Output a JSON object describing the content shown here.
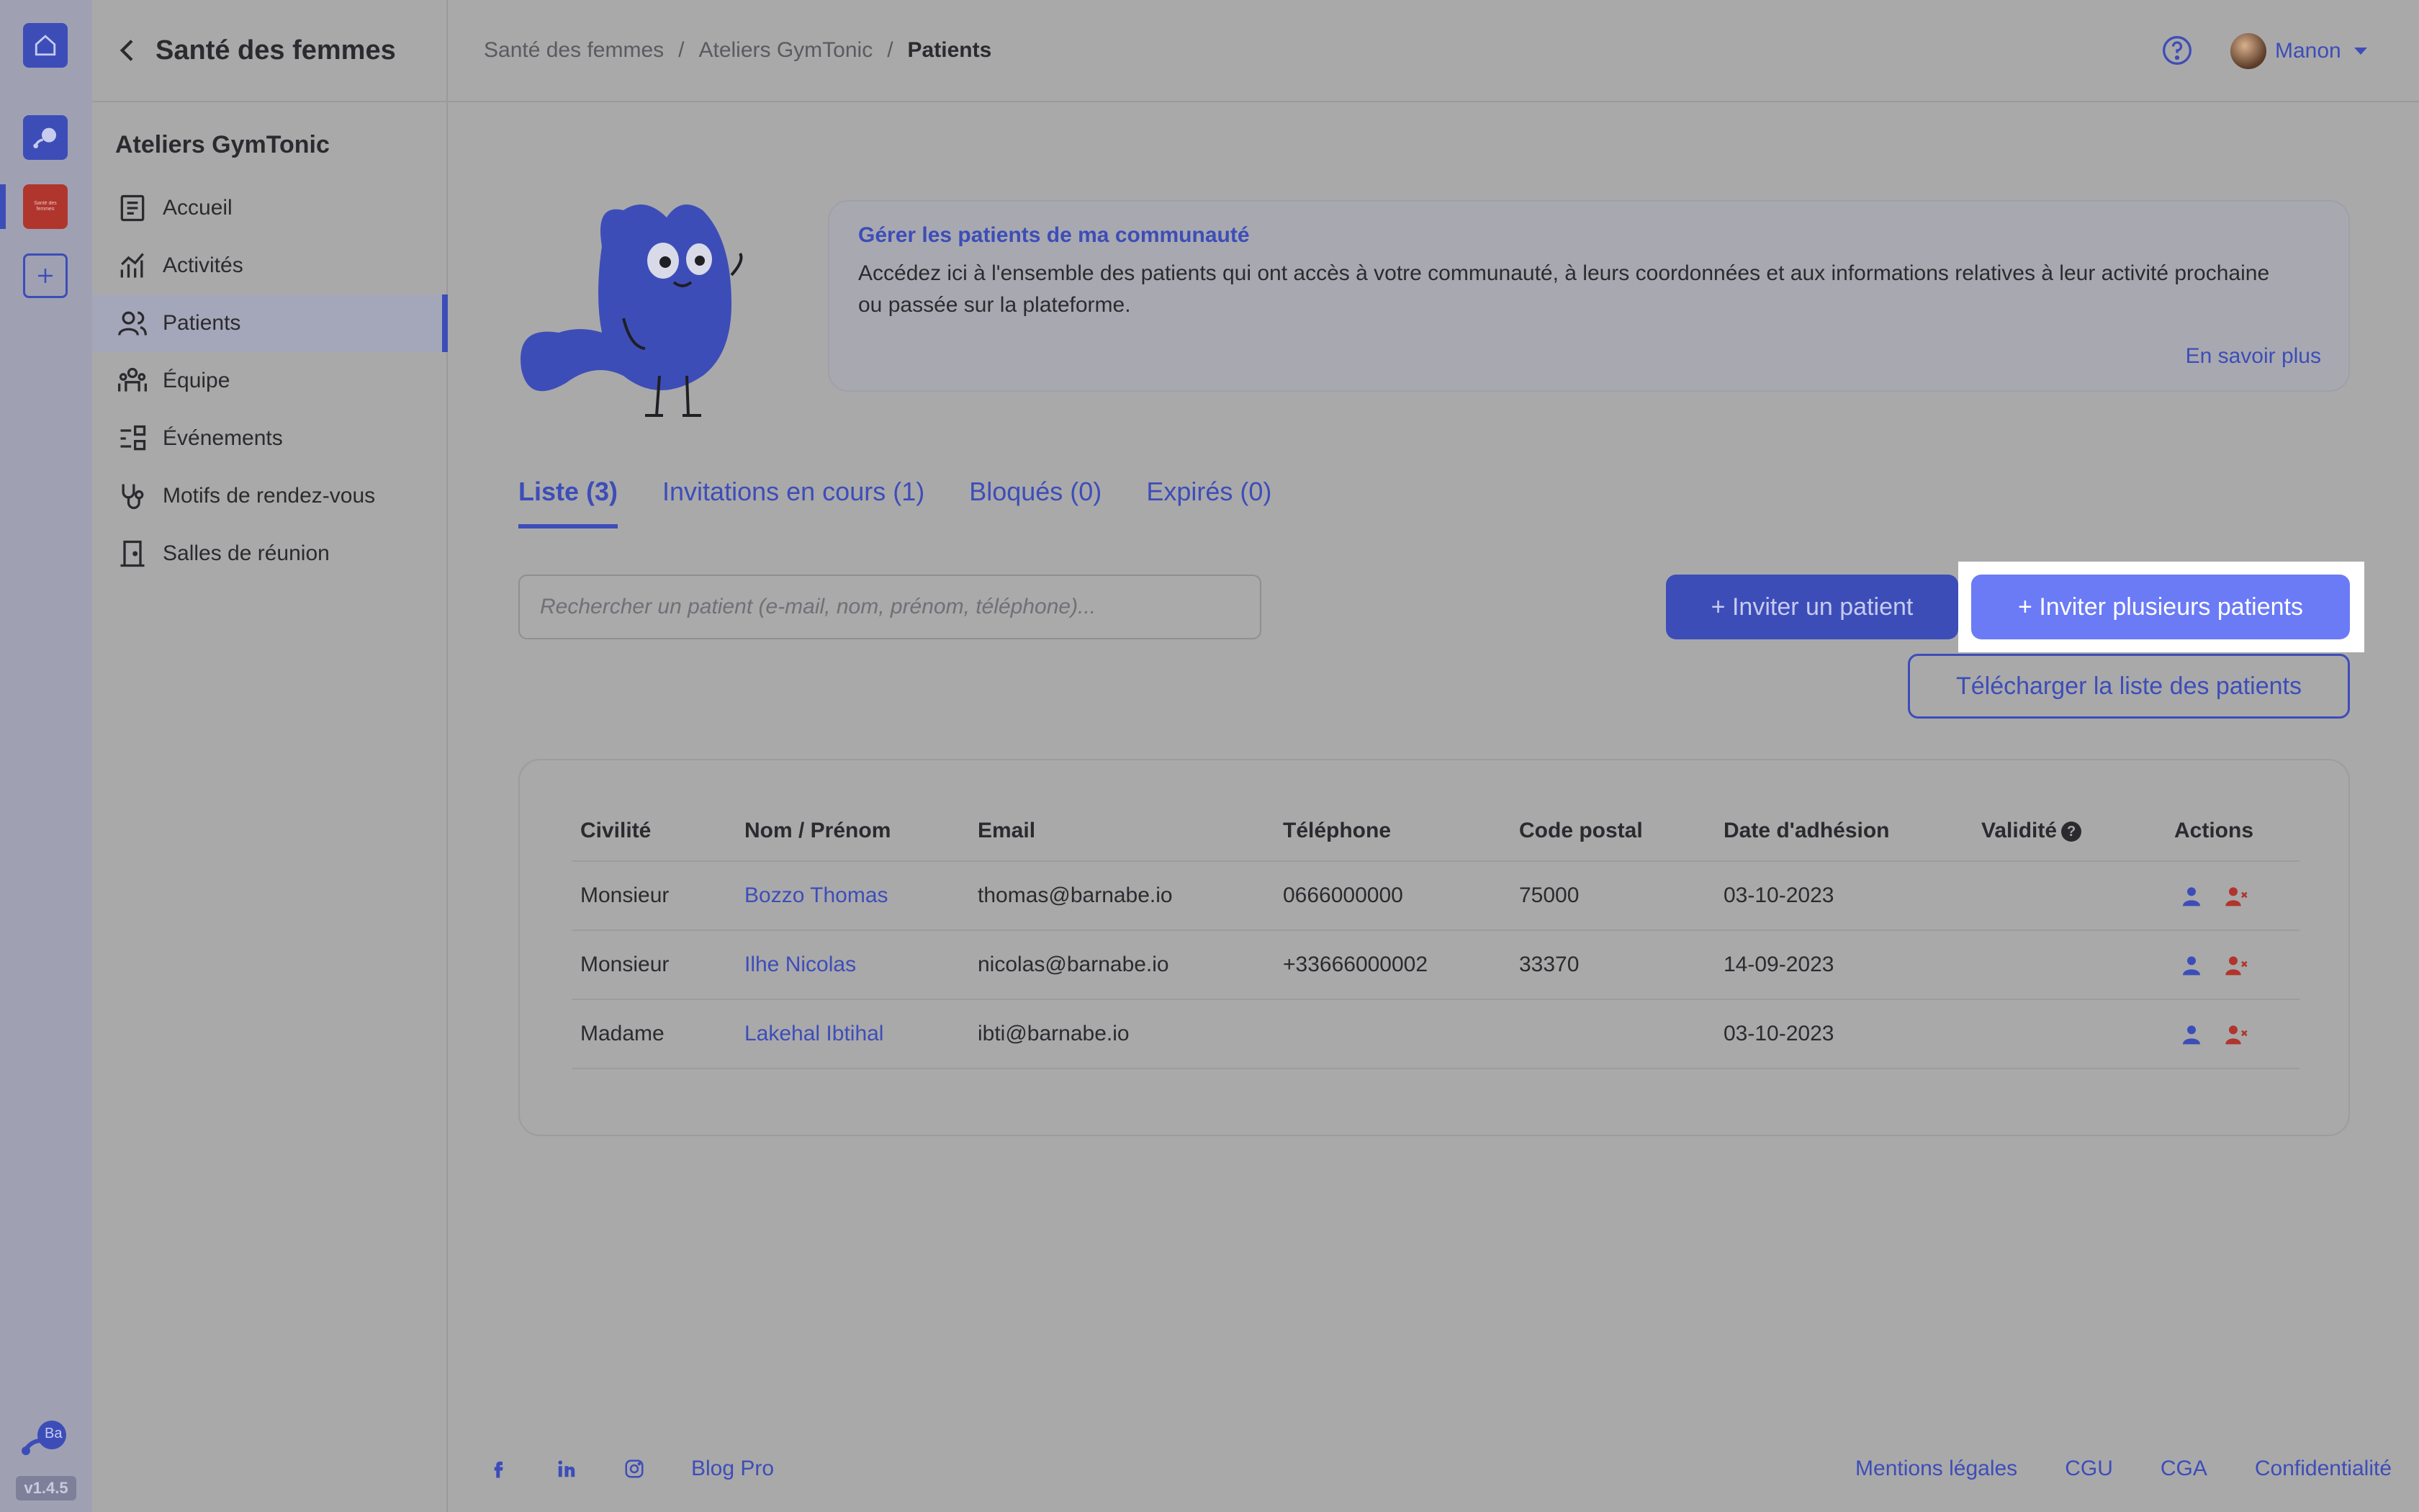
{
  "rail": {
    "app2_label": "Santé des femmes",
    "logo_label": "Ba",
    "version": "v1.4.5"
  },
  "sidebar": {
    "title": "Santé des femmes",
    "section": "Ateliers GymTonic",
    "items": [
      {
        "label": "Accueil",
        "icon": "document-icon"
      },
      {
        "label": "Activités",
        "icon": "chart-icon"
      },
      {
        "label": "Patients",
        "icon": "users-icon",
        "active": true
      },
      {
        "label": "Équipe",
        "icon": "team-icon"
      },
      {
        "label": "Événements",
        "icon": "events-icon"
      },
      {
        "label": "Motifs de rendez-vous",
        "icon": "stethoscope-icon"
      },
      {
        "label": "Salles de réunion",
        "icon": "door-icon"
      }
    ]
  },
  "breadcrumb": [
    "Santé des femmes",
    "Ateliers GymTonic",
    "Patients"
  ],
  "user": {
    "name": "Manon"
  },
  "info": {
    "title": "Gérer les patients de ma communauté",
    "text": "Accédez ici à l'ensemble des patients qui ont accès à votre communauté, à leurs coordonnées et aux informations relatives à leur activité prochaine ou passée sur la plateforme.",
    "more": "En savoir plus"
  },
  "tabs": [
    "Liste (3)",
    "Invitations en cours (1)",
    "Bloqués (0)",
    "Expirés (0)"
  ],
  "search": {
    "placeholder": "Rechercher un patient (e-mail, nom, prénom, téléphone)..."
  },
  "buttons": {
    "invite": "+ Inviter un patient",
    "invite_many": "+ Inviter plusieurs patients",
    "download": "Télécharger la liste des patients"
  },
  "table": {
    "headers": [
      "Civilité",
      "Nom / Prénom",
      "Email",
      "Téléphone",
      "Code postal",
      "Date d'adhésion",
      "Validité",
      "Actions"
    ],
    "rows": [
      [
        "Monsieur",
        "Bozzo Thomas",
        "thomas@barnabe.io",
        "0666000000",
        "75000",
        "03-10-2023",
        ""
      ],
      [
        "Monsieur",
        "Ilhe Nicolas",
        "nicolas@barnabe.io",
        "+33666000002",
        "33370",
        "14-09-2023",
        ""
      ],
      [
        "Madame",
        "Lakehal Ibtihal",
        "ibti@barnabe.io",
        "",
        "",
        "03-10-2023",
        ""
      ]
    ]
  },
  "footer": {
    "blog": "Blog Pro",
    "links": [
      "Mentions légales",
      "CGU",
      "CGA",
      "Confidentialité"
    ]
  },
  "colors": {
    "accent": "#3d4db8",
    "highlight_button": "#6b7bf5",
    "danger": "#b0352d"
  }
}
